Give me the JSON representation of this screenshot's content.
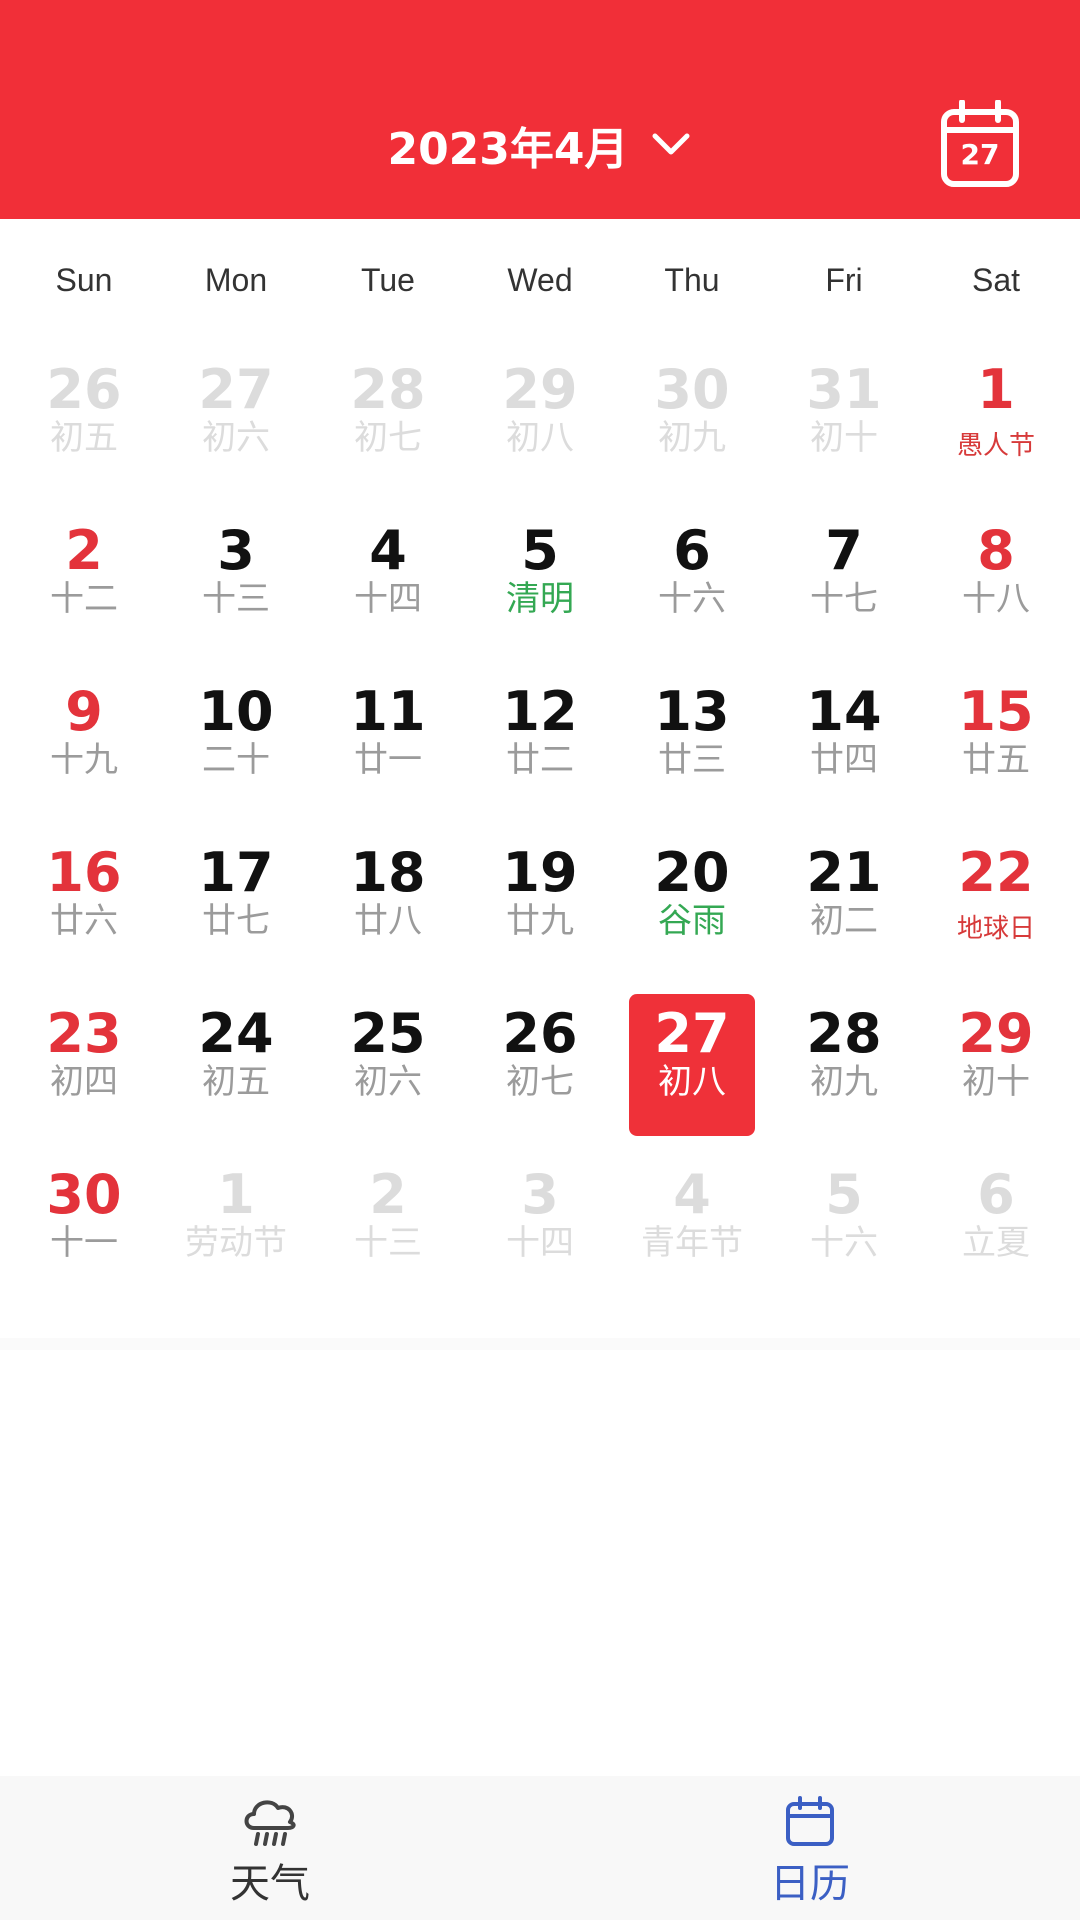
{
  "header": {
    "month_title": "2023年4月",
    "today_number": "27",
    "colors": {
      "background": "#f12f38",
      "text": "#ffffff"
    }
  },
  "weekdays": [
    "Sun",
    "Mon",
    "Tue",
    "Wed",
    "Thu",
    "Fri",
    "Sat"
  ],
  "days": [
    {
      "day": "26",
      "sub": "初五",
      "state": "dim"
    },
    {
      "day": "27",
      "sub": "初六",
      "state": "dim"
    },
    {
      "day": "28",
      "sub": "初七",
      "state": "dim"
    },
    {
      "day": "29",
      "sub": "初八",
      "state": "dim"
    },
    {
      "day": "30",
      "sub": "初九",
      "state": "dim"
    },
    {
      "day": "31",
      "sub": "初十",
      "state": "dim"
    },
    {
      "day": "1",
      "sub": "愚人节",
      "state": "red",
      "sub_type": "holiday"
    },
    {
      "day": "2",
      "sub": "十二",
      "state": "red"
    },
    {
      "day": "3",
      "sub": "十三",
      "state": "normal"
    },
    {
      "day": "4",
      "sub": "十四",
      "state": "normal"
    },
    {
      "day": "5",
      "sub": "清明",
      "state": "normal",
      "sub_type": "term"
    },
    {
      "day": "6",
      "sub": "十六",
      "state": "normal"
    },
    {
      "day": "7",
      "sub": "十七",
      "state": "normal"
    },
    {
      "day": "8",
      "sub": "十八",
      "state": "red"
    },
    {
      "day": "9",
      "sub": "十九",
      "state": "red"
    },
    {
      "day": "10",
      "sub": "二十",
      "state": "normal"
    },
    {
      "day": "11",
      "sub": "廿一",
      "state": "normal"
    },
    {
      "day": "12",
      "sub": "廿二",
      "state": "normal"
    },
    {
      "day": "13",
      "sub": "廿三",
      "state": "normal"
    },
    {
      "day": "14",
      "sub": "廿四",
      "state": "normal"
    },
    {
      "day": "15",
      "sub": "廿五",
      "state": "red"
    },
    {
      "day": "16",
      "sub": "廿六",
      "state": "red"
    },
    {
      "day": "17",
      "sub": "廿七",
      "state": "normal"
    },
    {
      "day": "18",
      "sub": "廿八",
      "state": "normal"
    },
    {
      "day": "19",
      "sub": "廿九",
      "state": "normal"
    },
    {
      "day": "20",
      "sub": "谷雨",
      "state": "normal",
      "sub_type": "term"
    },
    {
      "day": "21",
      "sub": "初二",
      "state": "normal"
    },
    {
      "day": "22",
      "sub": "地球日",
      "state": "red",
      "sub_type": "holiday"
    },
    {
      "day": "23",
      "sub": "初四",
      "state": "red"
    },
    {
      "day": "24",
      "sub": "初五",
      "state": "normal"
    },
    {
      "day": "25",
      "sub": "初六",
      "state": "normal"
    },
    {
      "day": "26",
      "sub": "初七",
      "state": "normal"
    },
    {
      "day": "27",
      "sub": "初八",
      "state": "selected"
    },
    {
      "day": "28",
      "sub": "初九",
      "state": "normal"
    },
    {
      "day": "29",
      "sub": "初十",
      "state": "red"
    },
    {
      "day": "30",
      "sub": "十一",
      "state": "red"
    },
    {
      "day": "1",
      "sub": "劳动节",
      "state": "dim",
      "sub_type": "holiday"
    },
    {
      "day": "2",
      "sub": "十三",
      "state": "dim"
    },
    {
      "day": "3",
      "sub": "十四",
      "state": "dim"
    },
    {
      "day": "4",
      "sub": "青年节",
      "state": "dim",
      "sub_type": "holiday"
    },
    {
      "day": "5",
      "sub": "十六",
      "state": "dim"
    },
    {
      "day": "6",
      "sub": "立夏",
      "state": "dim",
      "sub_type": "term"
    }
  ],
  "bottom_nav": {
    "weather": {
      "label": "天气",
      "icon": "cloud-rain-icon"
    },
    "calendar": {
      "label": "日历",
      "icon": "calendar-icon",
      "active_color": "#3b5fc4"
    }
  }
}
